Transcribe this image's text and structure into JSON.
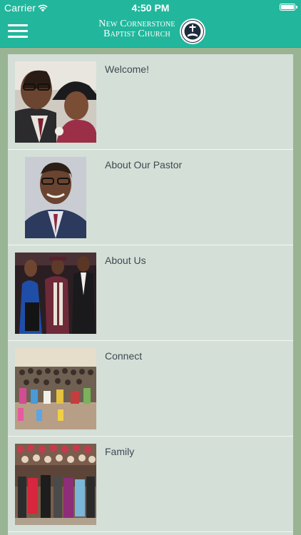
{
  "status_bar": {
    "carrier": "Carrier",
    "time": "4:50 PM",
    "icons": [
      "wifi-icon",
      "battery-icon"
    ]
  },
  "nav": {
    "menu_icon": "hamburger-menu-icon",
    "brand_line1": "New Cornerstone",
    "brand_line2": "Baptist Church",
    "seal_icon": "church-seal-logo"
  },
  "colors": {
    "header": "#22b79d",
    "page_background": "#98b493",
    "list_background": "#d4dfd8",
    "divider": "#f4f6f5",
    "title_text": "#3f4a52"
  },
  "menu_items": [
    {
      "label": "Welcome!",
      "image": "couple-photo"
    },
    {
      "label": "About Our Pastor",
      "image": "pastor-portrait"
    },
    {
      "label": "About Us",
      "image": "group-graduation-photo"
    },
    {
      "label": "Connect",
      "image": "congregation-gathering-photo"
    },
    {
      "label": "Family",
      "image": "church-family-photo"
    }
  ]
}
